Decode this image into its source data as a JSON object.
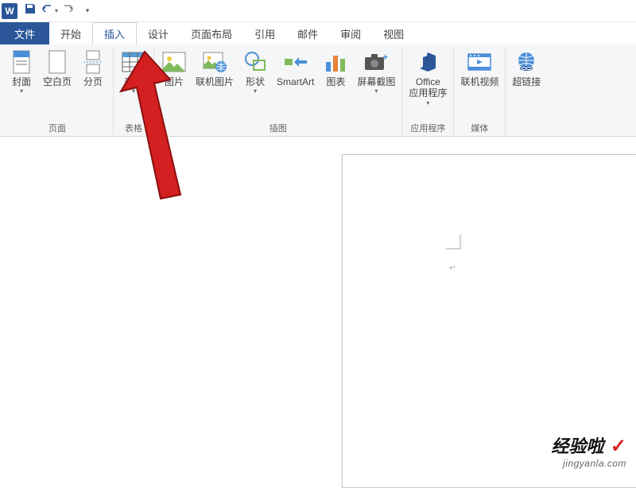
{
  "qat": {
    "app_logo": "W"
  },
  "tabs": {
    "file": "文件",
    "home": "开始",
    "insert": "插入",
    "design": "设计",
    "layout": "页面布局",
    "references": "引用",
    "mailings": "邮件",
    "review": "审阅",
    "view": "视图"
  },
  "ribbon": {
    "groups": {
      "page": {
        "label": "页面",
        "cover": "封面",
        "blank": "空白页",
        "break": "分页"
      },
      "table": {
        "label": "表格",
        "table": "表格"
      },
      "illustration": {
        "label": "插图",
        "picture": "图片",
        "online_picture": "联机图片",
        "shapes": "形状",
        "smartart": "SmartArt",
        "chart": "图表",
        "screenshot": "屏幕截图"
      },
      "apps": {
        "label": "应用程序",
        "office_apps": "Office\n应用程序"
      },
      "media": {
        "label": "媒体",
        "online_video": "联机视频"
      },
      "links": {
        "hyperlink": "超链接"
      }
    }
  },
  "watermark": {
    "brand": "经验啦",
    "check": "✓",
    "url": "jingyanla.com"
  },
  "colors": {
    "word_blue": "#2b579a",
    "ribbon_bg": "#f5f6f7",
    "arrow": "#d42020"
  }
}
